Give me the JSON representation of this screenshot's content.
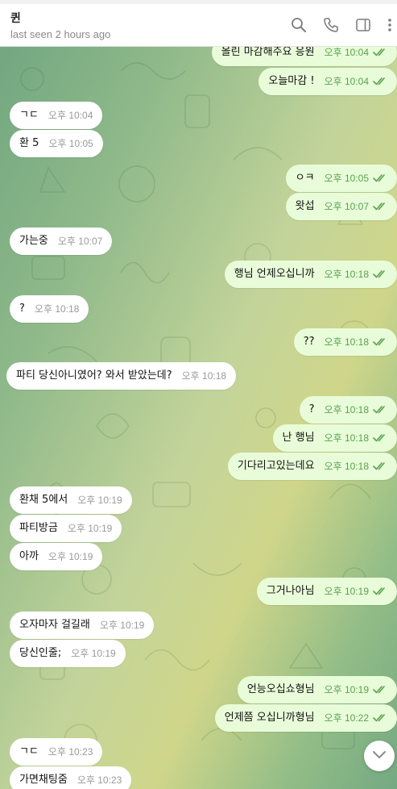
{
  "header": {
    "title": "퀸",
    "status": "last seen 2 hours ago",
    "icons": [
      "search-icon",
      "phone-icon",
      "sidebar-toggle-icon",
      "more-vertical-icon"
    ]
  },
  "messages": [
    {
      "direction": "out",
      "text": "올린 마감해주요 응원",
      "time": "오후 10:04",
      "read": true
    },
    {
      "direction": "out",
      "text": "오늘마감 !",
      "time": "오후 10:04",
      "read": true
    },
    {
      "direction": "in",
      "text": "ㄱㄷ",
      "time": "오후 10:04"
    },
    {
      "direction": "in",
      "text": "환 5",
      "time": "오후 10:05"
    },
    {
      "direction": "out",
      "text": "ㅇㅋ",
      "time": "오후 10:05",
      "read": true
    },
    {
      "direction": "out",
      "text": "왓섭",
      "time": "오후 10:07",
      "read": true
    },
    {
      "direction": "in",
      "text": "가는중",
      "time": "오후 10:07"
    },
    {
      "direction": "out",
      "text": "행님 언제오십니까",
      "time": "오후 10:18",
      "read": true
    },
    {
      "direction": "in",
      "text": "?",
      "time": "오후 10:18"
    },
    {
      "direction": "out",
      "text": "??",
      "time": "오후 10:18",
      "read": true
    },
    {
      "direction": "in",
      "text": "파티 당신아니였어? 와서 받았는데?",
      "time": "오후 10:18"
    },
    {
      "direction": "out",
      "text": "?",
      "time": "오후 10:18",
      "read": true
    },
    {
      "direction": "out",
      "text": "난 행님",
      "time": "오후 10:18",
      "read": true
    },
    {
      "direction": "out",
      "text": "기다리고있는데요",
      "time": "오후 10:18",
      "read": true
    },
    {
      "direction": "in",
      "text": "환채 5에서",
      "time": "오후 10:19"
    },
    {
      "direction": "in",
      "text": "파티방금",
      "time": "오후 10:19"
    },
    {
      "direction": "in",
      "text": "아까",
      "time": "오후 10:19"
    },
    {
      "direction": "out",
      "text": "그거나아님",
      "time": "오후 10:19",
      "read": true
    },
    {
      "direction": "in",
      "text": "오자마자 걸길래",
      "time": "오후 10:19"
    },
    {
      "direction": "in",
      "text": "당신인줄;",
      "time": "오후 10:19"
    },
    {
      "direction": "out",
      "text": "언능오십쇼형님",
      "time": "오후 10:19",
      "read": true
    },
    {
      "direction": "out",
      "text": "언제쯤 오십니까형님",
      "time": "오후 10:22",
      "read": true
    },
    {
      "direction": "in",
      "text": "ㄱㄷ",
      "time": "오후 10:23"
    },
    {
      "direction": "in",
      "text": "가면채팅줌",
      "time": "오후 10:23"
    }
  ],
  "colors": {
    "outgoing_bubble": "#e9fcd9",
    "incoming_bubble": "#ffffff",
    "outgoing_meta": "#58a24f",
    "incoming_meta": "#9a9a9a"
  },
  "scroll_button": {
    "icon": "chevron-down-icon"
  }
}
